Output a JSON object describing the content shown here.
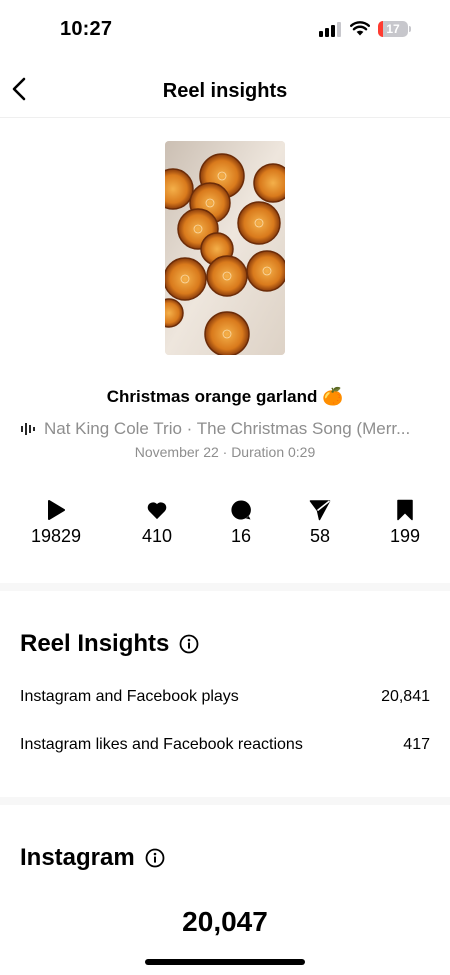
{
  "status_bar": {
    "time": "10:27",
    "battery": "17",
    "battery_level": 0.17
  },
  "nav": {
    "title": "Reel insights"
  },
  "reel": {
    "title": "Christmas orange garland 🍊",
    "audio": "Nat King Cole Trio · The Christmas Song (Merr...",
    "meta": "November 22 · Duration 0:29"
  },
  "stats": [
    {
      "icon": "play-icon",
      "value": "19829"
    },
    {
      "icon": "heart-icon",
      "value": "410"
    },
    {
      "icon": "comment-icon",
      "value": "16"
    },
    {
      "icon": "share-icon",
      "value": "58"
    },
    {
      "icon": "bookmark-icon",
      "value": "199"
    }
  ],
  "reel_insights": {
    "title": "Reel Insights",
    "rows": [
      {
        "label": "Instagram and Facebook plays",
        "value": "20,841"
      },
      {
        "label": "Instagram likes and Facebook reactions",
        "value": "417"
      }
    ]
  },
  "instagram": {
    "title": "Instagram",
    "total": "20,047"
  },
  "colors": {
    "secondary_text": "#8e8e8e",
    "battery_low": "#ff3b30",
    "divider": "#f7f7f7"
  }
}
